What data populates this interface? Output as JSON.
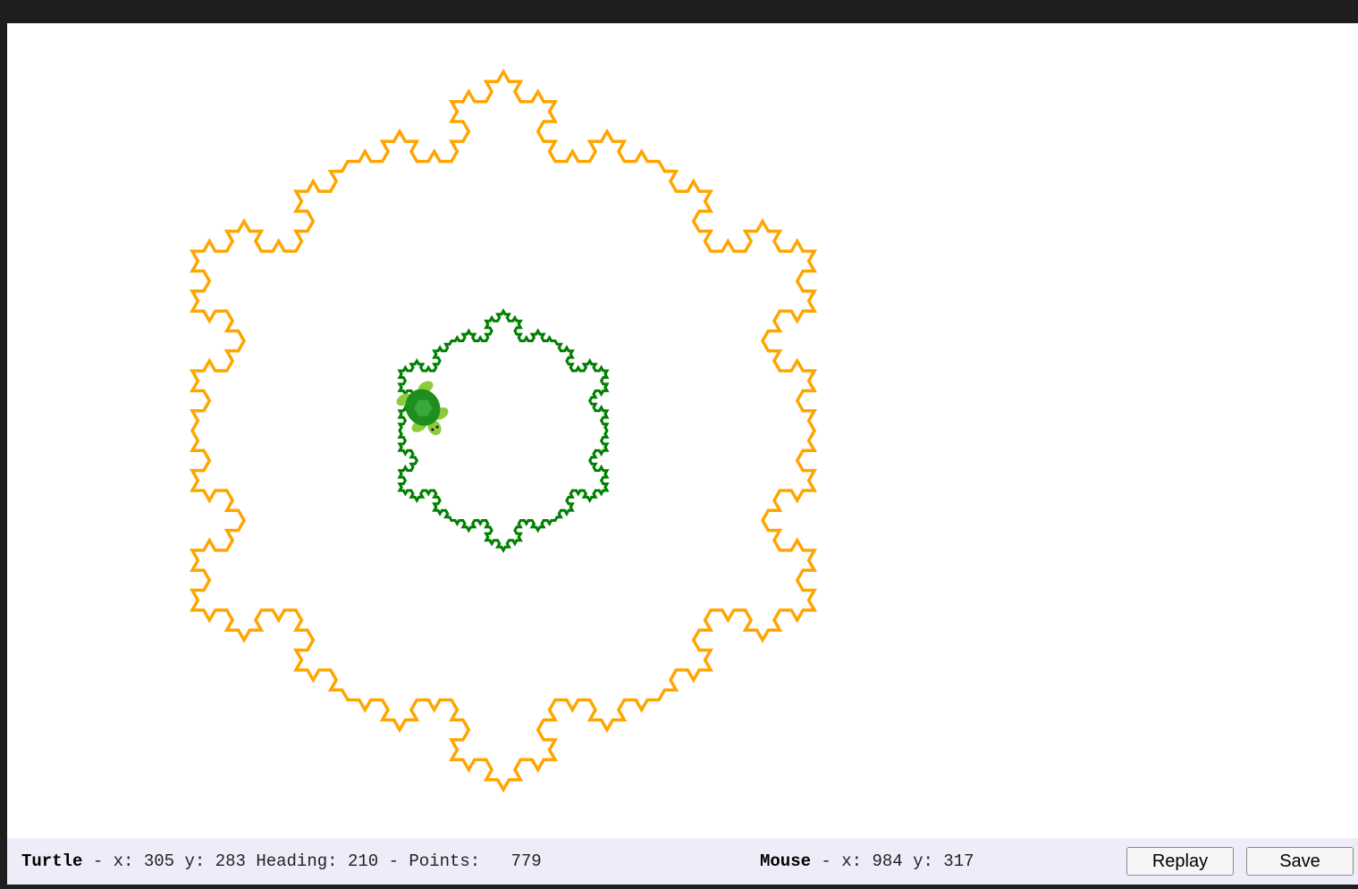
{
  "drawing": {
    "outer_curve_color": "#ffa500",
    "inner_curve_color": "#008000",
    "turtle_color": "#1e8f1e"
  },
  "status": {
    "turtle_label": "Turtle",
    "turtle_x_label": "x:",
    "turtle_x": "305",
    "turtle_y_label": "y:",
    "turtle_y": "283",
    "heading_label": "Heading:",
    "heading": "210",
    "points_label": "Points:",
    "points": "779",
    "mouse_label": "Mouse",
    "mouse_x_label": "x:",
    "mouse_x": "984",
    "mouse_y_label": "y:",
    "mouse_y": "317"
  },
  "buttons": {
    "replay": "Replay",
    "save": "Save"
  }
}
